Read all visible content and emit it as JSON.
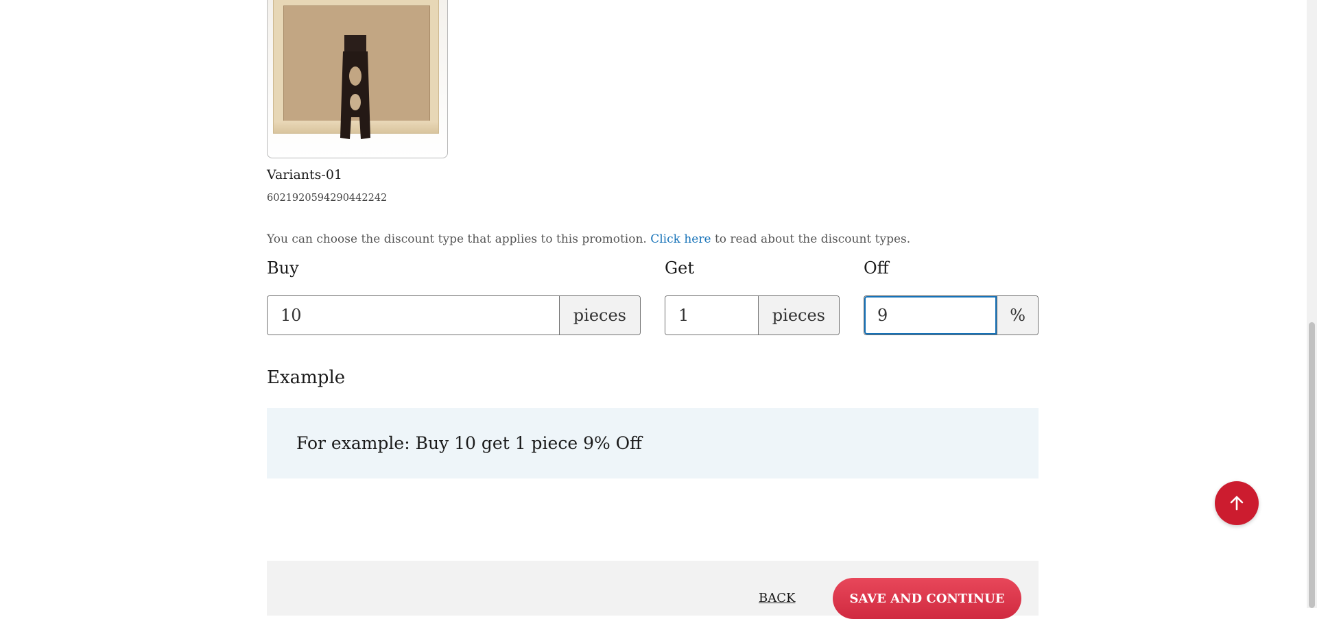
{
  "variant": {
    "name": "Variants-01",
    "sku": "6021920594290442242"
  },
  "info": {
    "before": "You can choose the discount type that applies to this promotion.",
    "link": "Click here",
    "after": "to read about the discount types."
  },
  "fields": {
    "buy": {
      "label": "Buy",
      "value": "10",
      "unit": "pieces"
    },
    "get": {
      "label": "Get",
      "value": "1",
      "unit": "pieces"
    },
    "off": {
      "label": "Off",
      "value": "9",
      "unit": "%"
    }
  },
  "example": {
    "heading": "Example",
    "text": "For example: Buy 10 get 1 piece 9% Off"
  },
  "footer": {
    "back_label": "BACK",
    "save_label": "SAVE AND CONTINUE"
  },
  "icons": {
    "scroll_top": "arrow-up-icon"
  },
  "colors": {
    "accent": "#cc1c2f",
    "link": "#1672b8",
    "focus": "#1672b8",
    "example_bg": "#eef5f9"
  }
}
